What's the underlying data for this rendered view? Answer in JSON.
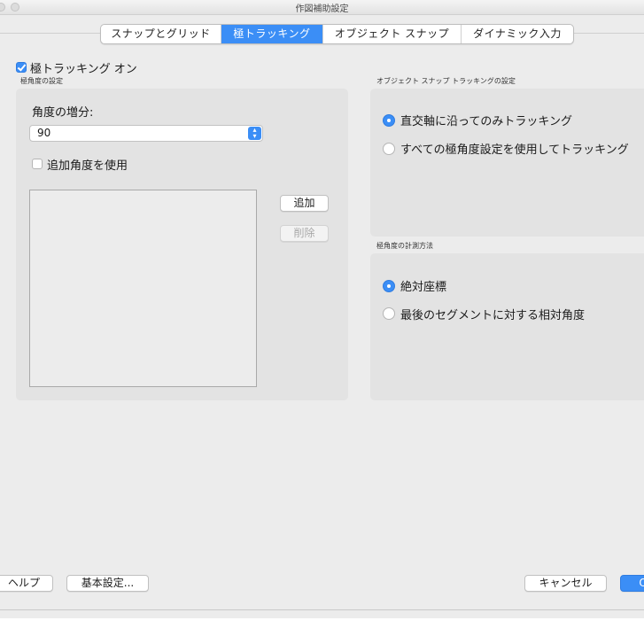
{
  "window": {
    "title": "作図補助設定"
  },
  "tabs": [
    {
      "label": "スナップとグリッド",
      "active": false
    },
    {
      "label": "極トラッキング",
      "active": true
    },
    {
      "label": "オブジェクト スナップ",
      "active": false
    },
    {
      "label": "ダイナミック入力",
      "active": false
    }
  ],
  "polar_tracking": {
    "enable_label": "極トラッキング オン",
    "checked": true
  },
  "polar_angle": {
    "group_title": "極角度の設定",
    "increment_label": "角度の増分:",
    "increment_value": "90",
    "additional_label": "追加角度を使用",
    "additional_checked": false,
    "add_button": "追加",
    "delete_button": "削除"
  },
  "osnap_tracking": {
    "group_title": "オブジェクト スナップ トラッキングの設定",
    "options": [
      {
        "label": "直交軸に沿ってのみトラッキング",
        "selected": true
      },
      {
        "label": "すべての極角度設定を使用してトラッキング",
        "selected": false
      }
    ]
  },
  "measurement": {
    "group_title": "極角度の計測方法",
    "options": [
      {
        "label": "絶対座標",
        "selected": true
      },
      {
        "label": "最後のセグメントに対する相対角度",
        "selected": false
      }
    ]
  },
  "footer": {
    "help_button": "ヘルプ",
    "settings_button": "基本設定...",
    "cancel_button": "キャンセル",
    "ok_button": "OK"
  },
  "colors": {
    "accent": "#3b8ef6",
    "window_bg": "#ececec",
    "group_bg": "#e3e3e3"
  }
}
